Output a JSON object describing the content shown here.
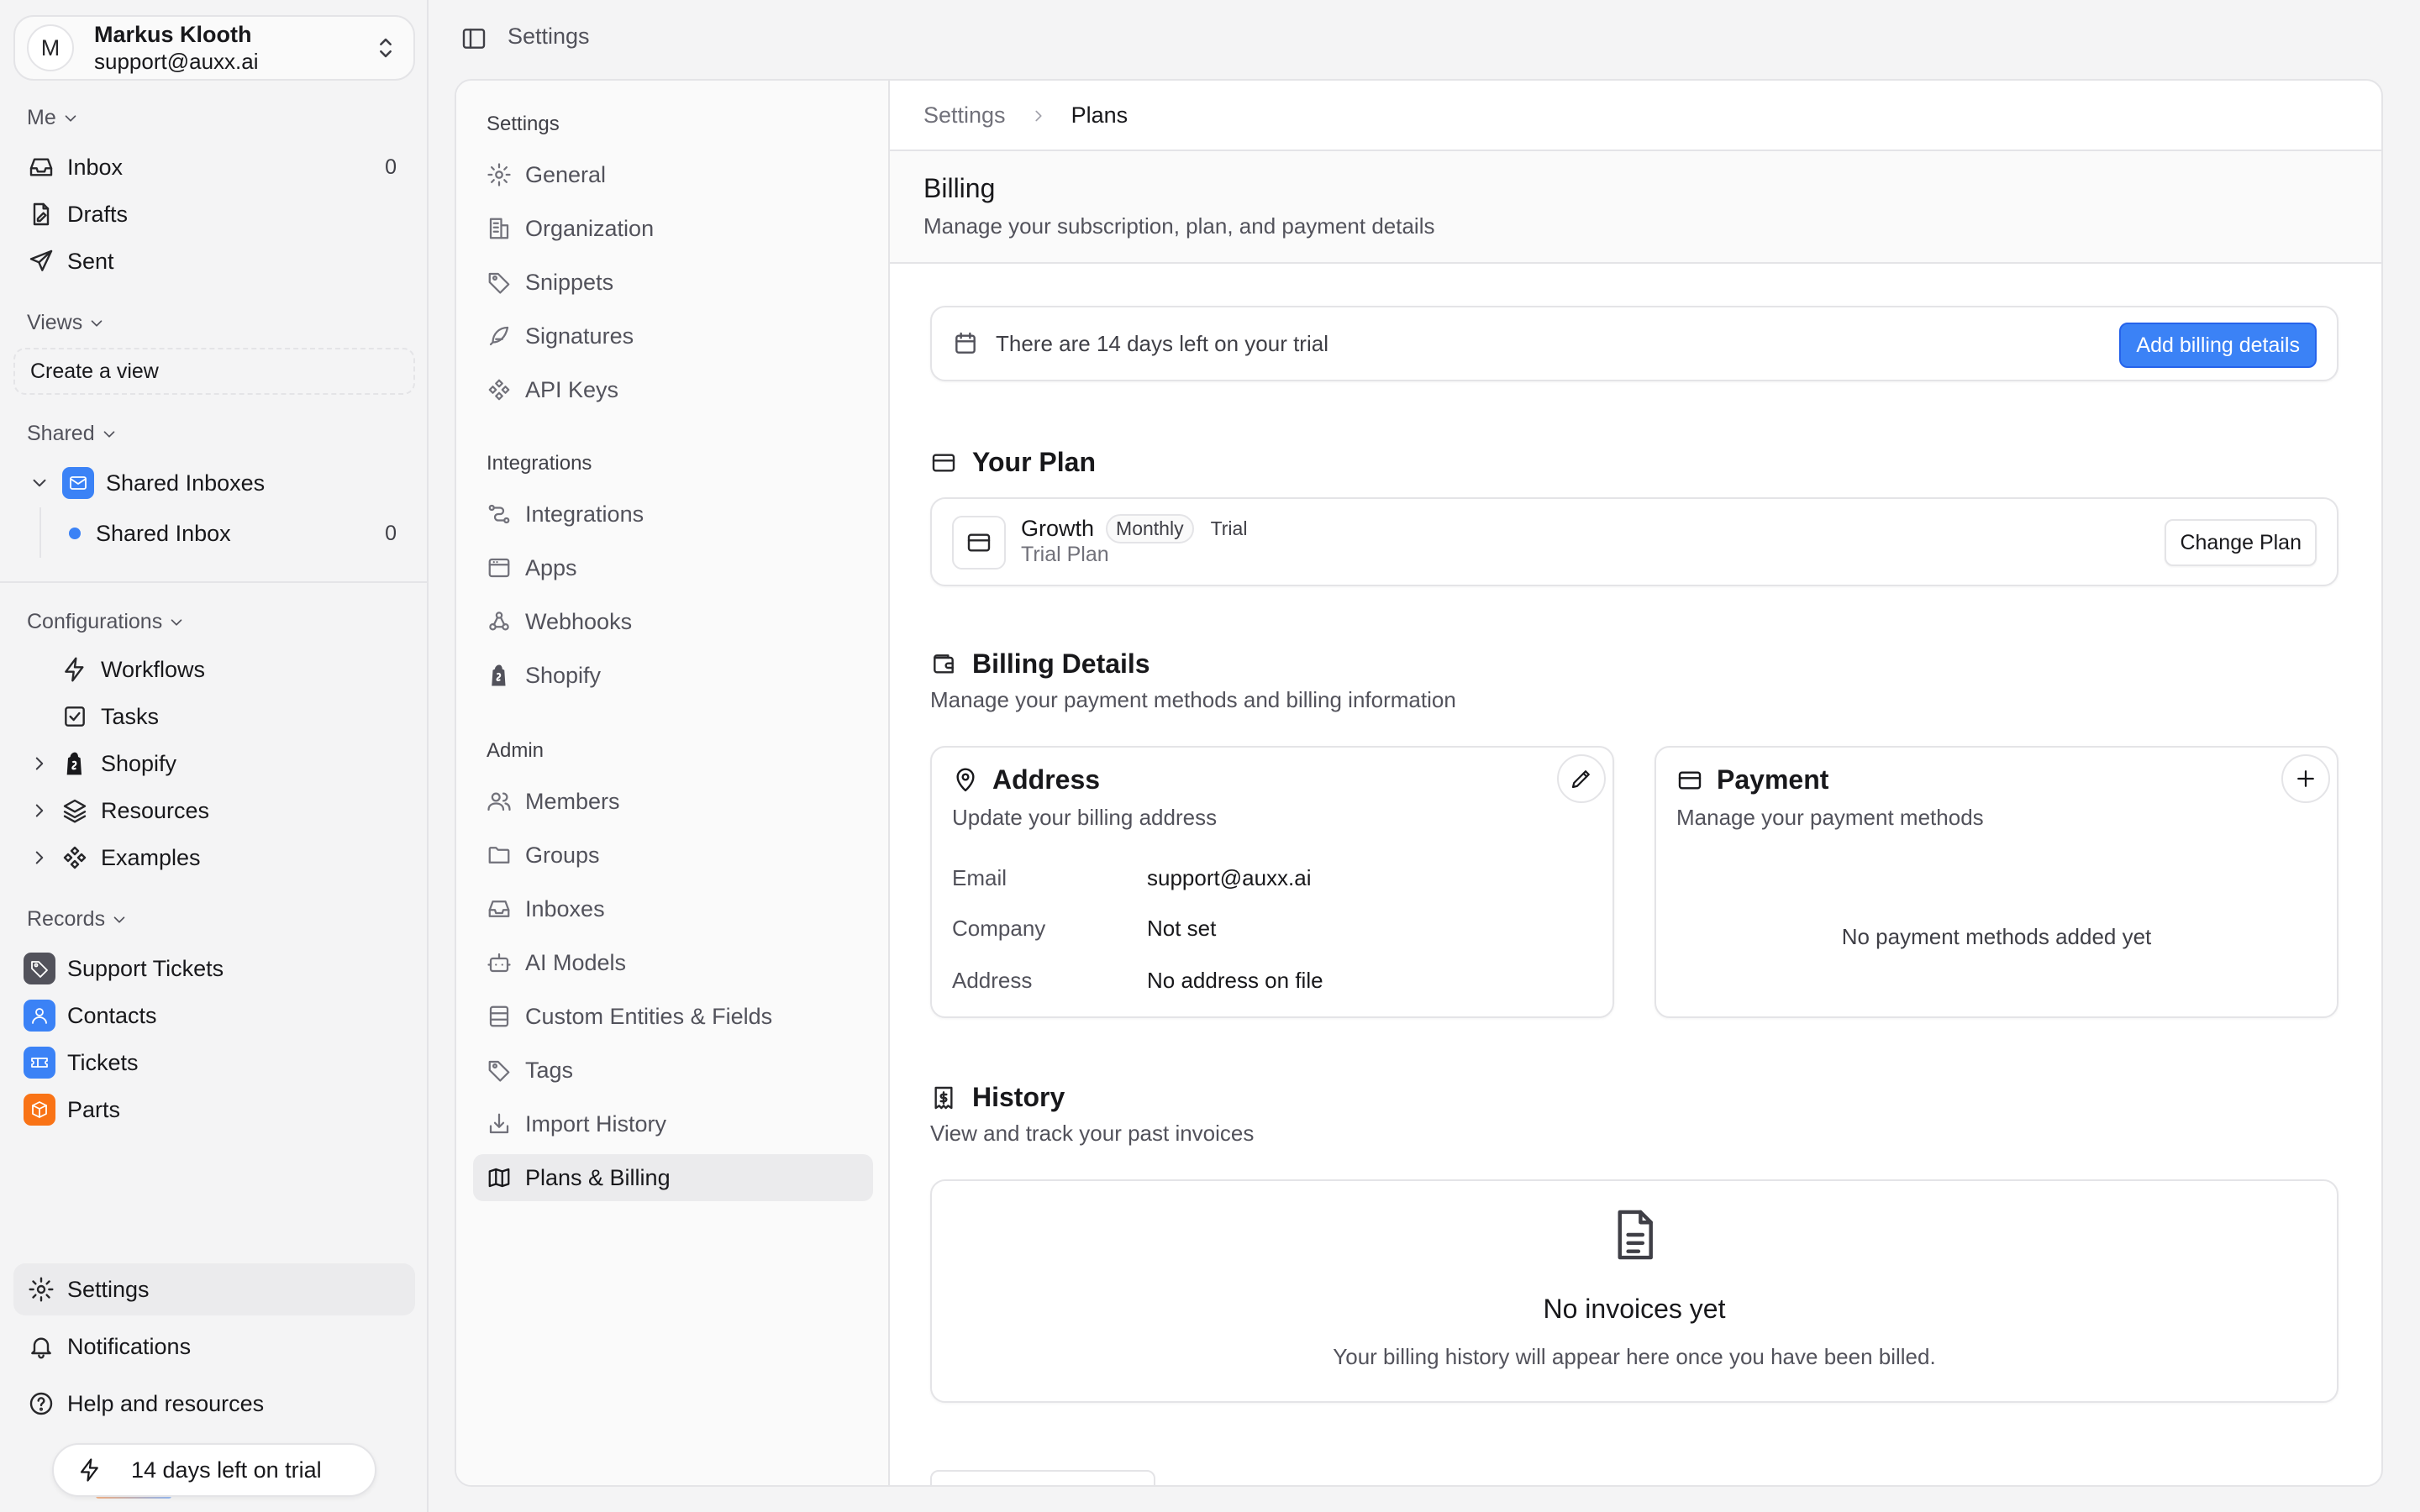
{
  "user": {
    "initial": "M",
    "name": "Markus Klooth",
    "email": "support@auxx.ai"
  },
  "sidebar": {
    "me_label": "Me",
    "me_items": [
      {
        "label": "Inbox",
        "count": "0",
        "icon": "inbox-icon"
      },
      {
        "label": "Drafts",
        "icon": "drafts-icon"
      },
      {
        "label": "Sent",
        "icon": "send-icon"
      }
    ],
    "views_label": "Views",
    "create_view": "Create a view",
    "shared_label": "Shared",
    "shared_inboxes": "Shared Inboxes",
    "shared_inbox": {
      "label": "Shared Inbox",
      "count": "0"
    },
    "configurations_label": "Configurations",
    "config_items": [
      "Workflows",
      "Tasks",
      "Shopify",
      "Resources",
      "Examples"
    ],
    "records_label": "Records",
    "records": [
      {
        "label": "Support Tickets",
        "color": "#52525b"
      },
      {
        "label": "Contacts",
        "color": "#3b82f6"
      },
      {
        "label": "Tickets",
        "color": "#3b82f6"
      },
      {
        "label": "Parts",
        "color": "#f97316"
      }
    ],
    "bottom": [
      "Settings",
      "Notifications",
      "Help and resources"
    ],
    "trial_pill": "14 days left on trial"
  },
  "topbar": {
    "title": "Settings"
  },
  "settings_nav": {
    "groups": [
      "Settings",
      "Integrations",
      "Admin"
    ],
    "settings_items": [
      "General",
      "Organization",
      "Snippets",
      "Signatures",
      "API Keys"
    ],
    "integration_items": [
      "Integrations",
      "Apps",
      "Webhooks",
      "Shopify"
    ],
    "admin_items": [
      "Members",
      "Groups",
      "Inboxes",
      "AI Models",
      "Custom Entities & Fields",
      "Tags",
      "Import History",
      "Plans & Billing"
    ],
    "active": "Plans & Billing"
  },
  "breadcrumb": {
    "parent": "Settings",
    "current": "Plans"
  },
  "page": {
    "title": "Billing",
    "subtitle": "Manage your subscription, plan, and payment details"
  },
  "trial_banner": {
    "message": "There are 14 days left on your trial",
    "button": "Add billing details"
  },
  "your_plan": {
    "title": "Your Plan",
    "plan_name": "Growth",
    "badge_interval": "Monthly",
    "badge_status": "Trial",
    "subtitle": "Trial Plan",
    "change_button": "Change Plan"
  },
  "billing_details": {
    "title": "Billing Details",
    "subtitle": "Manage your payment methods and billing information",
    "address": {
      "title": "Address",
      "subtitle": "Update your billing address",
      "rows": [
        {
          "key": "Email",
          "value": "support@auxx.ai"
        },
        {
          "key": "Company",
          "value": "Not set"
        },
        {
          "key": "Address",
          "value": "No address on file"
        }
      ]
    },
    "payment": {
      "title": "Payment",
      "subtitle": "Manage your payment methods",
      "empty": "No payment methods added yet"
    }
  },
  "history": {
    "title": "History",
    "subtitle": "View and track your past invoices",
    "empty_title": "No invoices yet",
    "empty_sub": "Your billing history will appear here once you have been billed."
  },
  "colors": {
    "accent": "#3b82f6",
    "accent_border": "#2563eb",
    "orange": "#f97316"
  }
}
